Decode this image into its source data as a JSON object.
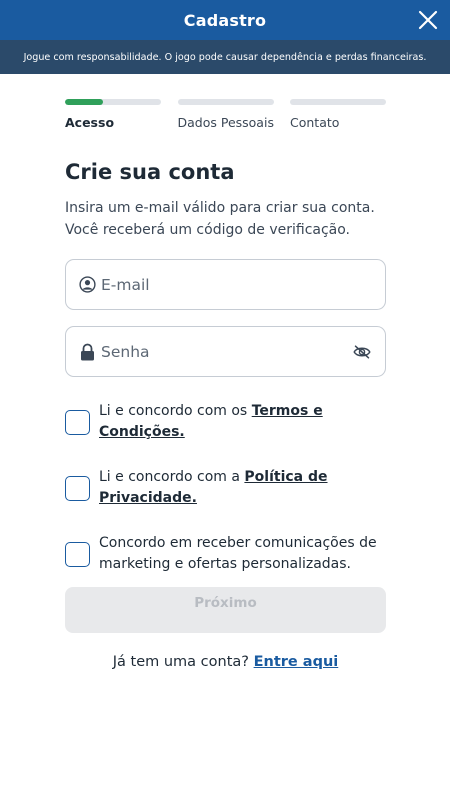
{
  "header": {
    "title": "Cadastro",
    "close_icon": "close-icon"
  },
  "notice": {
    "text": "Jogue com responsabilidade. O jogo pode causar dependência e perdas financeiras."
  },
  "steps": [
    {
      "label": "Acesso",
      "active": true,
      "progress": 0.4
    },
    {
      "label": "Dados Pessoais",
      "active": false,
      "progress": 0
    },
    {
      "label": "Contato",
      "active": false,
      "progress": 0
    }
  ],
  "form": {
    "title": "Crie sua conta",
    "subtitle": "Insira um e-mail válido para criar sua conta.\nVocê receberá um código de verificação.",
    "email": {
      "placeholder": "E-mail",
      "value": "",
      "icon": "user-icon"
    },
    "password": {
      "placeholder": "Senha",
      "value": "",
      "icon": "lock-icon",
      "toggle_icon": "eye-off-icon"
    },
    "checks": [
      {
        "text": "Li e concordo com os ",
        "link": "Termos e Condições.",
        "checked": false
      },
      {
        "text": "Li e concordo com a ",
        "link": "Política de Privacidade.",
        "checked": false
      },
      {
        "text": "Concordo em receber comunicações de marketing e ofertas personalizadas.",
        "link": "",
        "checked": false
      }
    ],
    "next_label": "Próximo",
    "login_prompt": "Já tem uma conta? ",
    "login_link": "Entre aqui"
  },
  "colors": {
    "header_bg": "#1a5ba0",
    "notice_bg": "#2b4a6a",
    "progress": "#2fa05a",
    "link": "#1a5ba0",
    "disabled_button": "#e8e9eb"
  }
}
